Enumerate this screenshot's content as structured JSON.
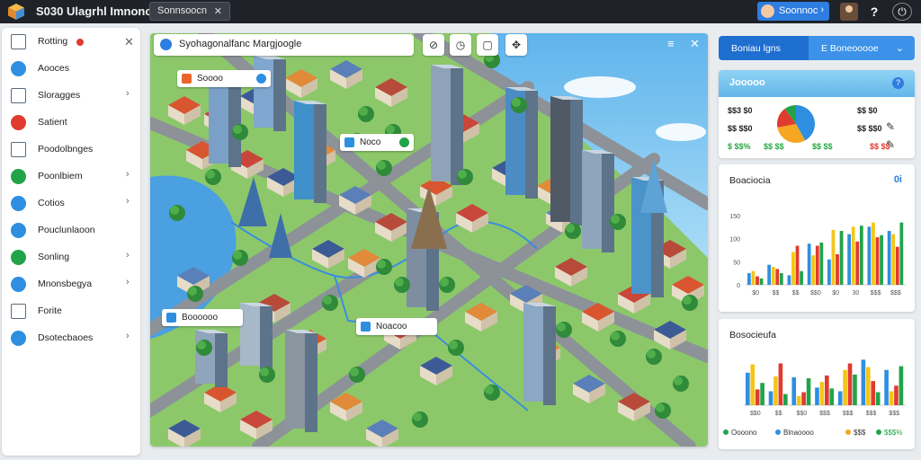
{
  "topbar": {
    "title": "S030 Ulagrhl Imnonce",
    "select_value": "Sonnsoocn",
    "user_label": "Soonnoc"
  },
  "sidebar": {
    "items": [
      {
        "label": "Rotting",
        "icon": "document-icon",
        "color": "#5a6b7d",
        "badge": true,
        "chevron": false
      },
      {
        "label": "Aooces",
        "icon": "circle-icon",
        "color": "#2e8fe0",
        "badge": false,
        "chevron": false
      },
      {
        "label": "Sloragges",
        "icon": "list-icon",
        "color": "#5a6b7d",
        "badge": false,
        "chevron": true
      },
      {
        "label": "Satient",
        "icon": "alert-icon",
        "color": "#e03b2f",
        "badge": false,
        "chevron": false
      },
      {
        "label": "Poodolbnges",
        "icon": "pencil-icon",
        "color": "#5a6b7d",
        "badge": false,
        "chevron": false
      },
      {
        "label": "Poonlbiem",
        "icon": "circle-icon",
        "color": "#22a34a",
        "badge": false,
        "chevron": true
      },
      {
        "label": "Cotios",
        "icon": "circle-icon",
        "color": "#2e8fe0",
        "badge": false,
        "chevron": true
      },
      {
        "label": "Pouclunlaoon",
        "icon": "circle-icon",
        "color": "#2e8fe0",
        "badge": false,
        "chevron": false
      },
      {
        "label": "Sonling",
        "icon": "circle-icon",
        "color": "#22a34a",
        "badge": false,
        "chevron": true
      },
      {
        "label": "Mnonsbegya",
        "icon": "circle-icon",
        "color": "#2e8fe0",
        "badge": false,
        "chevron": true
      },
      {
        "label": "Forite",
        "icon": "grid-icon",
        "color": "#5a6b7d",
        "badge": false,
        "chevron": false
      },
      {
        "label": "Dsotecbaoes",
        "icon": "circle-icon",
        "color": "#2e8fe0",
        "badge": false,
        "chevron": true
      }
    ]
  },
  "map": {
    "title": "Syohagonalfanc Margjoogle",
    "labels": {
      "a": "Soooo",
      "b": "Noco",
      "c": "Boooooo",
      "d": "Noacoo"
    }
  },
  "right_panel": {
    "tab_a": "Boniau lgns",
    "tab_b": "E Boneooooe",
    "overview": {
      "title": "Jooooo",
      "stats_left": [
        "$$3 $0",
        "$$ $$0",
        "$ $$%"
      ],
      "stats_left_sub": [
        "",
        "",
        "$$ $$"
      ],
      "stats_right": [
        "$$ $0",
        "$$ $$0",
        "$$ $$"
      ],
      "stats_right_sub": [
        "",
        "",
        "$$ $$"
      ],
      "pie": [
        {
          "value": 42,
          "color": "#2e8fe0"
        },
        {
          "value": 30,
          "color": "#f5a623"
        },
        {
          "value": 18,
          "color": "#e03b2f"
        },
        {
          "value": 10,
          "color": "#22a34a"
        }
      ]
    },
    "chart1": {
      "title": "Boaciocia",
      "icon": "0і",
      "y_ticks": [
        "0",
        "50",
        "100",
        "150"
      ],
      "x_ticks": [
        "$0",
        "$$",
        "$$",
        "$$0",
        "$0",
        "30",
        "$$$",
        "$$$"
      ]
    },
    "chart2": {
      "title": "Bosocieufa",
      "x_ticks": [
        "$$0",
        "$$",
        "$$0",
        "$$$",
        "$$$",
        "$$$",
        "$$$"
      ],
      "footer": [
        "Oooono",
        "Blnaoooo",
        "$$$",
        "$$$%"
      ]
    }
  },
  "chart_data": [
    {
      "type": "bar",
      "title": "Boaciocia",
      "ylim": [
        0,
        160
      ],
      "categories": [
        "$0",
        "$$",
        "$$",
        "$$0",
        "$0",
        "30",
        "$$$",
        "$$$"
      ],
      "series": [
        {
          "color": "#2e8fe0",
          "values": [
            22,
            38,
            18,
            78,
            48,
            96,
            110,
            102
          ]
        },
        {
          "color": "#f5c518",
          "values": [
            26,
            34,
            62,
            56,
            104,
            110,
            118,
            96
          ]
        },
        {
          "color": "#e03b2f",
          "values": [
            16,
            30,
            74,
            74,
            58,
            82,
            90,
            72
          ]
        },
        {
          "color": "#22a34a",
          "values": [
            12,
            22,
            26,
            80,
            102,
            112,
            94,
            118
          ]
        }
      ]
    },
    {
      "type": "bar",
      "title": "Bosocieufa",
      "ylim": [
        0,
        120
      ],
      "categories": [
        "$$0",
        "$$",
        "$$0",
        "$$$",
        "$$$",
        "$$$",
        "$$$"
      ],
      "series": [
        {
          "color": "#2e8fe0",
          "values": [
            70,
            30,
            60,
            38,
            30,
            98,
            76
          ]
        },
        {
          "color": "#f5c518",
          "values": [
            88,
            62,
            20,
            50,
            76,
            82,
            30
          ]
        },
        {
          "color": "#e03b2f",
          "values": [
            34,
            90,
            28,
            64,
            90,
            52,
            42
          ]
        },
        {
          "color": "#22a34a",
          "values": [
            48,
            24,
            58,
            36,
            66,
            28,
            84
          ]
        }
      ]
    }
  ]
}
